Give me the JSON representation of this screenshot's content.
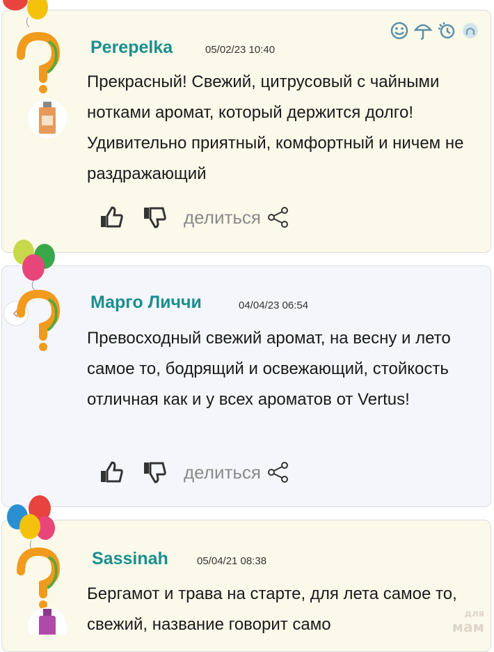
{
  "reviews": [
    {
      "author": "Perepelka",
      "date": "05/02/23 10:40",
      "text": "Прекрасный! Свежий, цитрусовый с чайными нотками аромат, который держится долго! Удивительно приятный, комфортный и ничем не раздражающий",
      "share_label": "делиться"
    },
    {
      "author": "Марго Личчи",
      "date": "04/04/23 06:54",
      "text": "Превосходный свежий аромат, на весну и лето самое то, бодрящий и освежающий, стойкость отличная как и у всех ароматов от Vertus!",
      "share_label": "делиться"
    },
    {
      "author": "Sassinah",
      "date": "05/04/21 08:38",
      "text": "Бергамот и трава на старте, для лета самое то, свежий, название говорит само",
      "share_label": ""
    }
  ],
  "top_icons": [
    "smile-icon",
    "umbrella-icon",
    "sun-clock-icon",
    "user-icon"
  ],
  "watermark": {
    "line1": "для",
    "line2": "мам"
  },
  "colors": {
    "author": "#1a8f8f",
    "card_yellow": "#fbf9ea",
    "card_blue": "#f5f6fb",
    "icons": "#5b8fa8",
    "action_icons": "#333333"
  }
}
